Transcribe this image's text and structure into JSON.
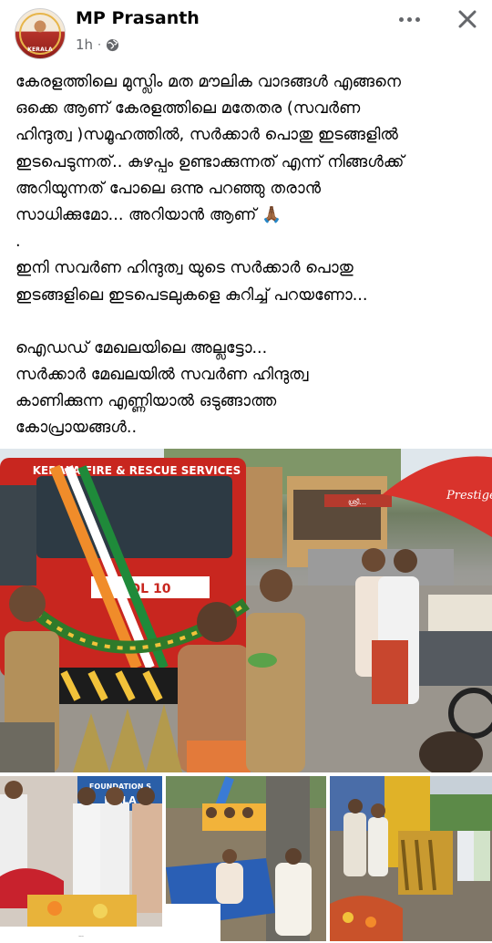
{
  "post": {
    "author": "MP Prasanth",
    "time": "1h",
    "separator": "·",
    "visibility_icon": "globe-icon",
    "avatar_text": "KERALA",
    "lines": [
      "കേരളത്തിലെ മുസ്ലിം മത മൗലിക വാദങ്ങൾ എങ്ങനെ",
      "ഒക്കെ ആണ് കേരളത്തിലെ മതേതര (സവർണ",
      "ഹിന്ദുത്വ )സമൂഹത്തിൽ, സർക്കാർ പൊതു ഇടങ്ങളിൽ",
      "ഇടപെടുന്നത്.. കുഴപ്പം ഉണ്ടാക്കുന്നത് എന്ന് നിങ്ങൾക്ക്",
      "അറിയുന്നത് പോലെ ഒന്നു പറഞ്ഞു തരാൻ",
      "സാധിക്കുമോ... അറിയാൻ ആണ് 🙏🏾",
      ".",
      "ഇനി സവർണ ഹിന്ദുത്വ യുടെ സർക്കാർ പൊതു",
      "ഇടങ്ങളിലെ ഇടപെടലുകളെ കുറിച്ച് പറയണോ...",
      "",
      "ഐഡഡ് മേഖലയിലെ അല്ലട്ടോ...",
      "സർക്കാർ മേഖലയിൽ സവർണ ഹിന്ദുത്വ",
      "കാണിക്കുന്ന എണ്ണിയാൽ ഒടുങ്ങാത്ത",
      "കോപ്രായങ്ങൾ.."
    ]
  },
  "photos": {
    "main": {
      "truck_text": "KERALA FIRE & RESCUE SERVICES",
      "truck_number": "DL 10",
      "umbrella_text": "Prestige",
      "shop_sign": "ശ്രീ..."
    },
    "grid1": {
      "banner_text": "FOUNDATION S",
      "banner_text2": "E   ALA",
      "caption": "..."
    }
  },
  "colors": {
    "name": "#050505",
    "meta": "#65676b",
    "truck_red": "#c8261f",
    "umbrella_red": "#d9332c"
  }
}
